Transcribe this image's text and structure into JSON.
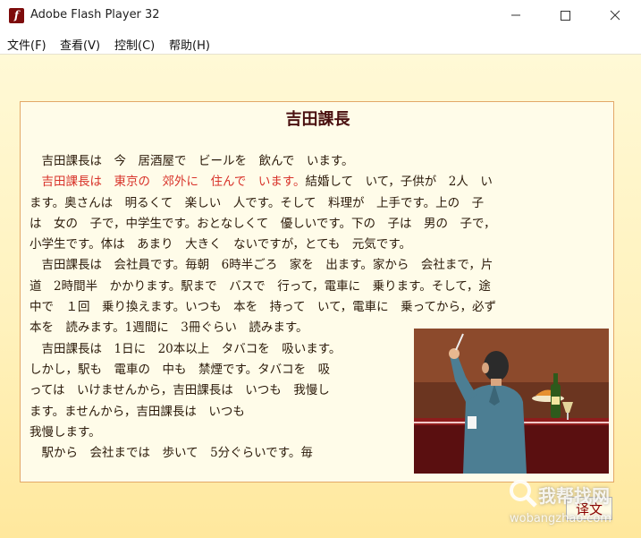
{
  "window": {
    "title": "Adobe Flash Player 32",
    "icon": "flash-player-icon",
    "controls": [
      "minimize-icon",
      "maximize-icon",
      "close-icon"
    ]
  },
  "menu": [
    {
      "label": "文件(F)"
    },
    {
      "label": "查看(V)"
    },
    {
      "label": "控制(C)"
    },
    {
      "label": "帮助(H)"
    }
  ],
  "lesson": {
    "title": "吉田課長",
    "lines": [
      {
        "pre": "　吉田課長は　今　居酒屋で　ビールを　飲んで　います。",
        "hl": "",
        "post": ""
      },
      {
        "pre": "　",
        "hl": "吉田課長は　東京の　郊外に　住んで　います。",
        "post": "結婚して　いて，子供が　2人　い"
      },
      {
        "pre": "ます。奥さんは　明るくて　楽しい　人です。そして　料理が　上手です。上の　子",
        "hl": "",
        "post": ""
      },
      {
        "pre": "は　女の　子で，中学生です。おとなしくて　優しいです。下の　子は　男の　子で，",
        "hl": "",
        "post": ""
      },
      {
        "pre": "小学生です。体は　あまり　大きく　ないですが，とても　元気です。",
        "hl": "",
        "post": ""
      },
      {
        "pre": "　吉田課長は　会社員です。毎朝　6時半ごろ　家を　出ます。家から　会社まで，片",
        "hl": "",
        "post": ""
      },
      {
        "pre": "道　2時間半　かかります。駅まで　バスで　行って，電車に　乗ります。そして，途",
        "hl": "",
        "post": ""
      },
      {
        "pre": "中で　１回　乗り換えます。いつも　本を　持って　いて，電車に　乗ってから，必ず",
        "hl": "",
        "post": ""
      },
      {
        "pre": "本を　読みます。1週間に　3冊ぐらい　読みます。",
        "hl": "",
        "post": ""
      },
      {
        "pre": "　吉田課長は　1日に　20本以上　タバコを　吸います。",
        "hl": "",
        "post": ""
      },
      {
        "pre": "しかし，駅も　電車の　中も　禁煙です。タバコを　吸",
        "hl": "",
        "post": ""
      },
      {
        "pre": "っては　いけませんから，吉田課長は　いつも　我慢し",
        "hl": "",
        "post": ""
      },
      {
        "pre": "ます。ませんから，吉田課長は　いつも",
        "hl": "",
        "post": ""
      },
      {
        "pre": "我慢します。",
        "hl": "",
        "post": ""
      },
      {
        "pre": "　駅から　会社までは　歩いて　5分ぐらいです。毎",
        "hl": "",
        "post": ""
      }
    ]
  },
  "translate_button": "译文",
  "watermark": {
    "text": "我帮找网",
    "url": "wobangzhao.com"
  },
  "colors": {
    "highlight": "#d8332a",
    "title": "#4a1010",
    "card_border": "#e3a868",
    "background": "#fff2bd"
  }
}
